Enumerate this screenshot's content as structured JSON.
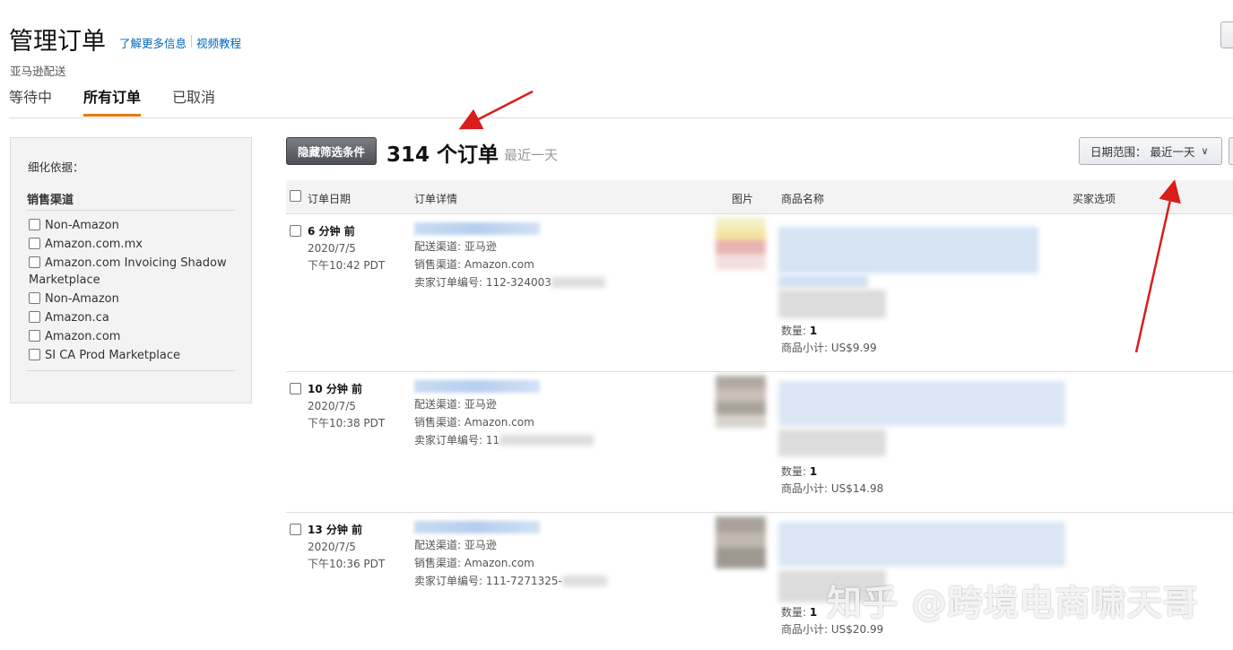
{
  "header": {
    "title": "管理订单",
    "learn_more": "了解更多信息",
    "video_tutorial": "视频教程",
    "subtitle": "亚马逊配送"
  },
  "tabs": [
    {
      "label": "等待中",
      "active": false
    },
    {
      "label": "所有订单",
      "active": true
    },
    {
      "label": "已取消",
      "active": false
    }
  ],
  "filter": {
    "title": "细化依据：",
    "group_title": "销售渠道",
    "options": [
      "Non-Amazon",
      "Amazon.com.mx",
      "Amazon.com Invoicing Shadow Marketplace",
      "Non-Amazon",
      "Amazon.ca",
      "Amazon.com",
      "SI CA Prod Marketplace"
    ]
  },
  "toolbar": {
    "hide_filter": "隐藏筛选条件",
    "order_count": "314 个订单",
    "range_text": "最近一天",
    "date_range": "日期范围： 最近一天"
  },
  "table": {
    "headers": {
      "date": "订单日期",
      "details": "订单详情",
      "image": "图片",
      "product": "商品名称",
      "buyer": "买家选项"
    },
    "rows": [
      {
        "ago": "6 分钟 前",
        "date": "2020/7/5",
        "time": "下午10:42 PDT",
        "shipping": "配送渠道: 亚马逊",
        "channel": "销售渠道: Amazon.com",
        "order_no": "卖家订单编号: 112-324003",
        "qty_label": "数量:",
        "qty": "1",
        "subtotal": "商品小计: US$9.99"
      },
      {
        "ago": "10 分钟 前",
        "date": "2020/7/5",
        "time": "下午10:38 PDT",
        "shipping": "配送渠道: 亚马逊",
        "channel": "销售渠道: Amazon.com",
        "order_no": "卖家订单编号: 11",
        "qty_label": "数量:",
        "qty": "1",
        "subtotal": "商品小计: US$14.98"
      },
      {
        "ago": "13 分钟 前",
        "date": "2020/7/5",
        "time": "下午10:36 PDT",
        "shipping": "配送渠道: 亚马逊",
        "channel": "销售渠道: Amazon.com",
        "order_no": "卖家订单编号: 111-7271325-",
        "qty_label": "数量:",
        "qty": "1",
        "subtotal": "商品小计: US$20.99"
      }
    ]
  },
  "watermark": "知乎 @跨境电商啸天哥",
  "colors": {
    "link": "#0066c0",
    "tab_underline": "#e47911",
    "annotation_arrow": "#d91c1c"
  }
}
